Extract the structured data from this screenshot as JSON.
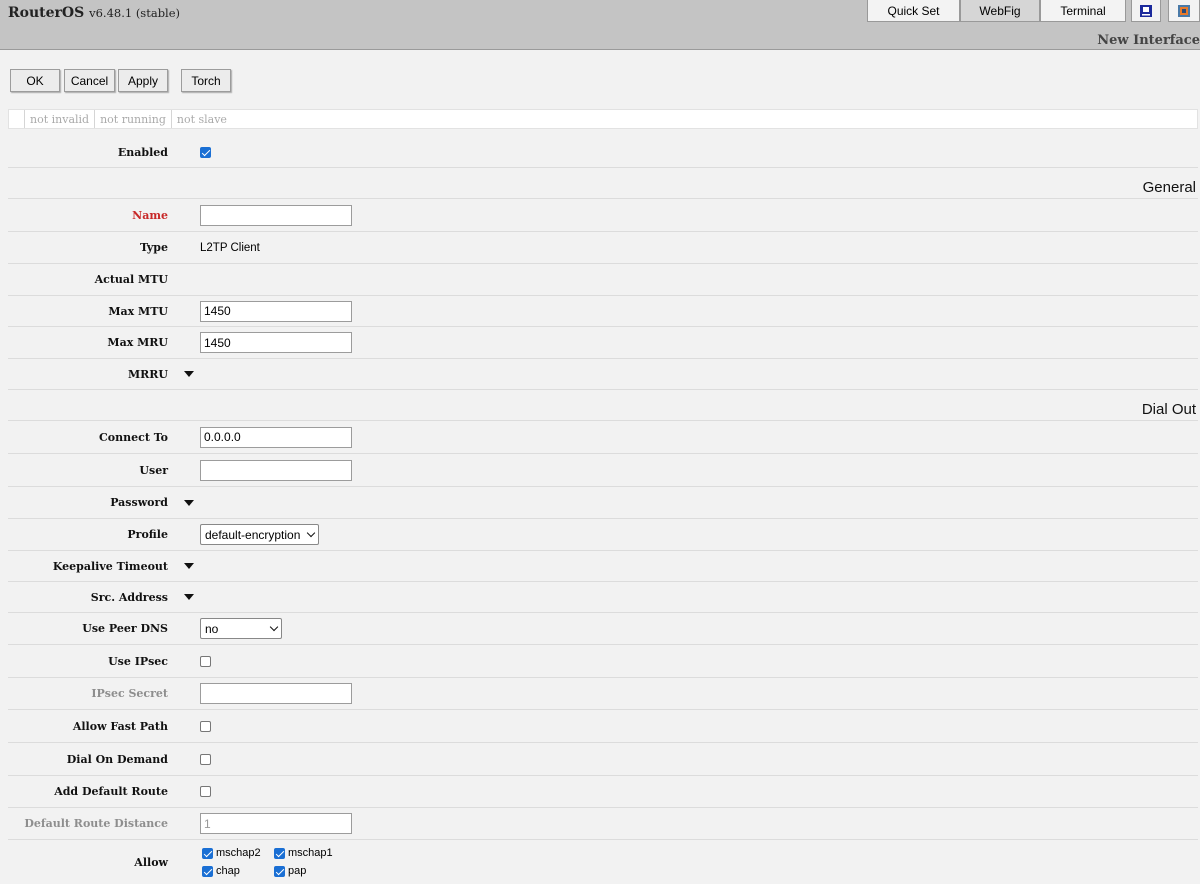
{
  "app": {
    "name": "RouterOS",
    "version": "v6.48.1 (stable)"
  },
  "topnav": {
    "quickset": "Quick Set",
    "webfig": "WebFig",
    "terminal": "Terminal"
  },
  "page_title": "New Interface",
  "actions": {
    "ok": "OK",
    "cancel": "Cancel",
    "apply": "Apply",
    "torch": "Torch"
  },
  "status_flags": [
    "not invalid",
    "not running",
    "not slave"
  ],
  "sections": {
    "general": "General",
    "dial_out": "Dial Out"
  },
  "fields": {
    "enabled": {
      "label": "Enabled",
      "checked": true
    },
    "name": {
      "label": "Name",
      "value": ""
    },
    "type": {
      "label": "Type",
      "value": "L2TP Client"
    },
    "actual_mtu": {
      "label": "Actual MTU",
      "value": ""
    },
    "max_mtu": {
      "label": "Max MTU",
      "value": "1450"
    },
    "max_mru": {
      "label": "Max MRU",
      "value": "1450"
    },
    "mrru": {
      "label": "MRRU"
    },
    "connect_to": {
      "label": "Connect To",
      "value": "0.0.0.0"
    },
    "user": {
      "label": "User",
      "value": ""
    },
    "password": {
      "label": "Password"
    },
    "profile": {
      "label": "Profile",
      "value": "default-encryption"
    },
    "keepalive": {
      "label": "Keepalive Timeout"
    },
    "src_address": {
      "label": "Src. Address"
    },
    "use_peer_dns": {
      "label": "Use Peer DNS",
      "value": "no"
    },
    "use_ipsec": {
      "label": "Use IPsec",
      "checked": false
    },
    "ipsec_secret": {
      "label": "IPsec Secret",
      "value": ""
    },
    "allow_fast_path": {
      "label": "Allow Fast Path",
      "checked": false
    },
    "dial_on_demand": {
      "label": "Dial On Demand",
      "checked": false
    },
    "add_default_route": {
      "label": "Add Default Route",
      "checked": false
    },
    "default_route_distance": {
      "label": "Default Route Distance",
      "value": "1"
    },
    "allow": {
      "label": "Allow",
      "options": [
        {
          "name": "mschap2",
          "checked": true
        },
        {
          "name": "mschap1",
          "checked": true
        },
        {
          "name": "chap",
          "checked": true
        },
        {
          "name": "pap",
          "checked": true
        }
      ]
    }
  },
  "colors": {
    "required_label": "#c82828",
    "disabled_label": "#8e8e8e",
    "checkbox_on": "#1a6fd4"
  }
}
